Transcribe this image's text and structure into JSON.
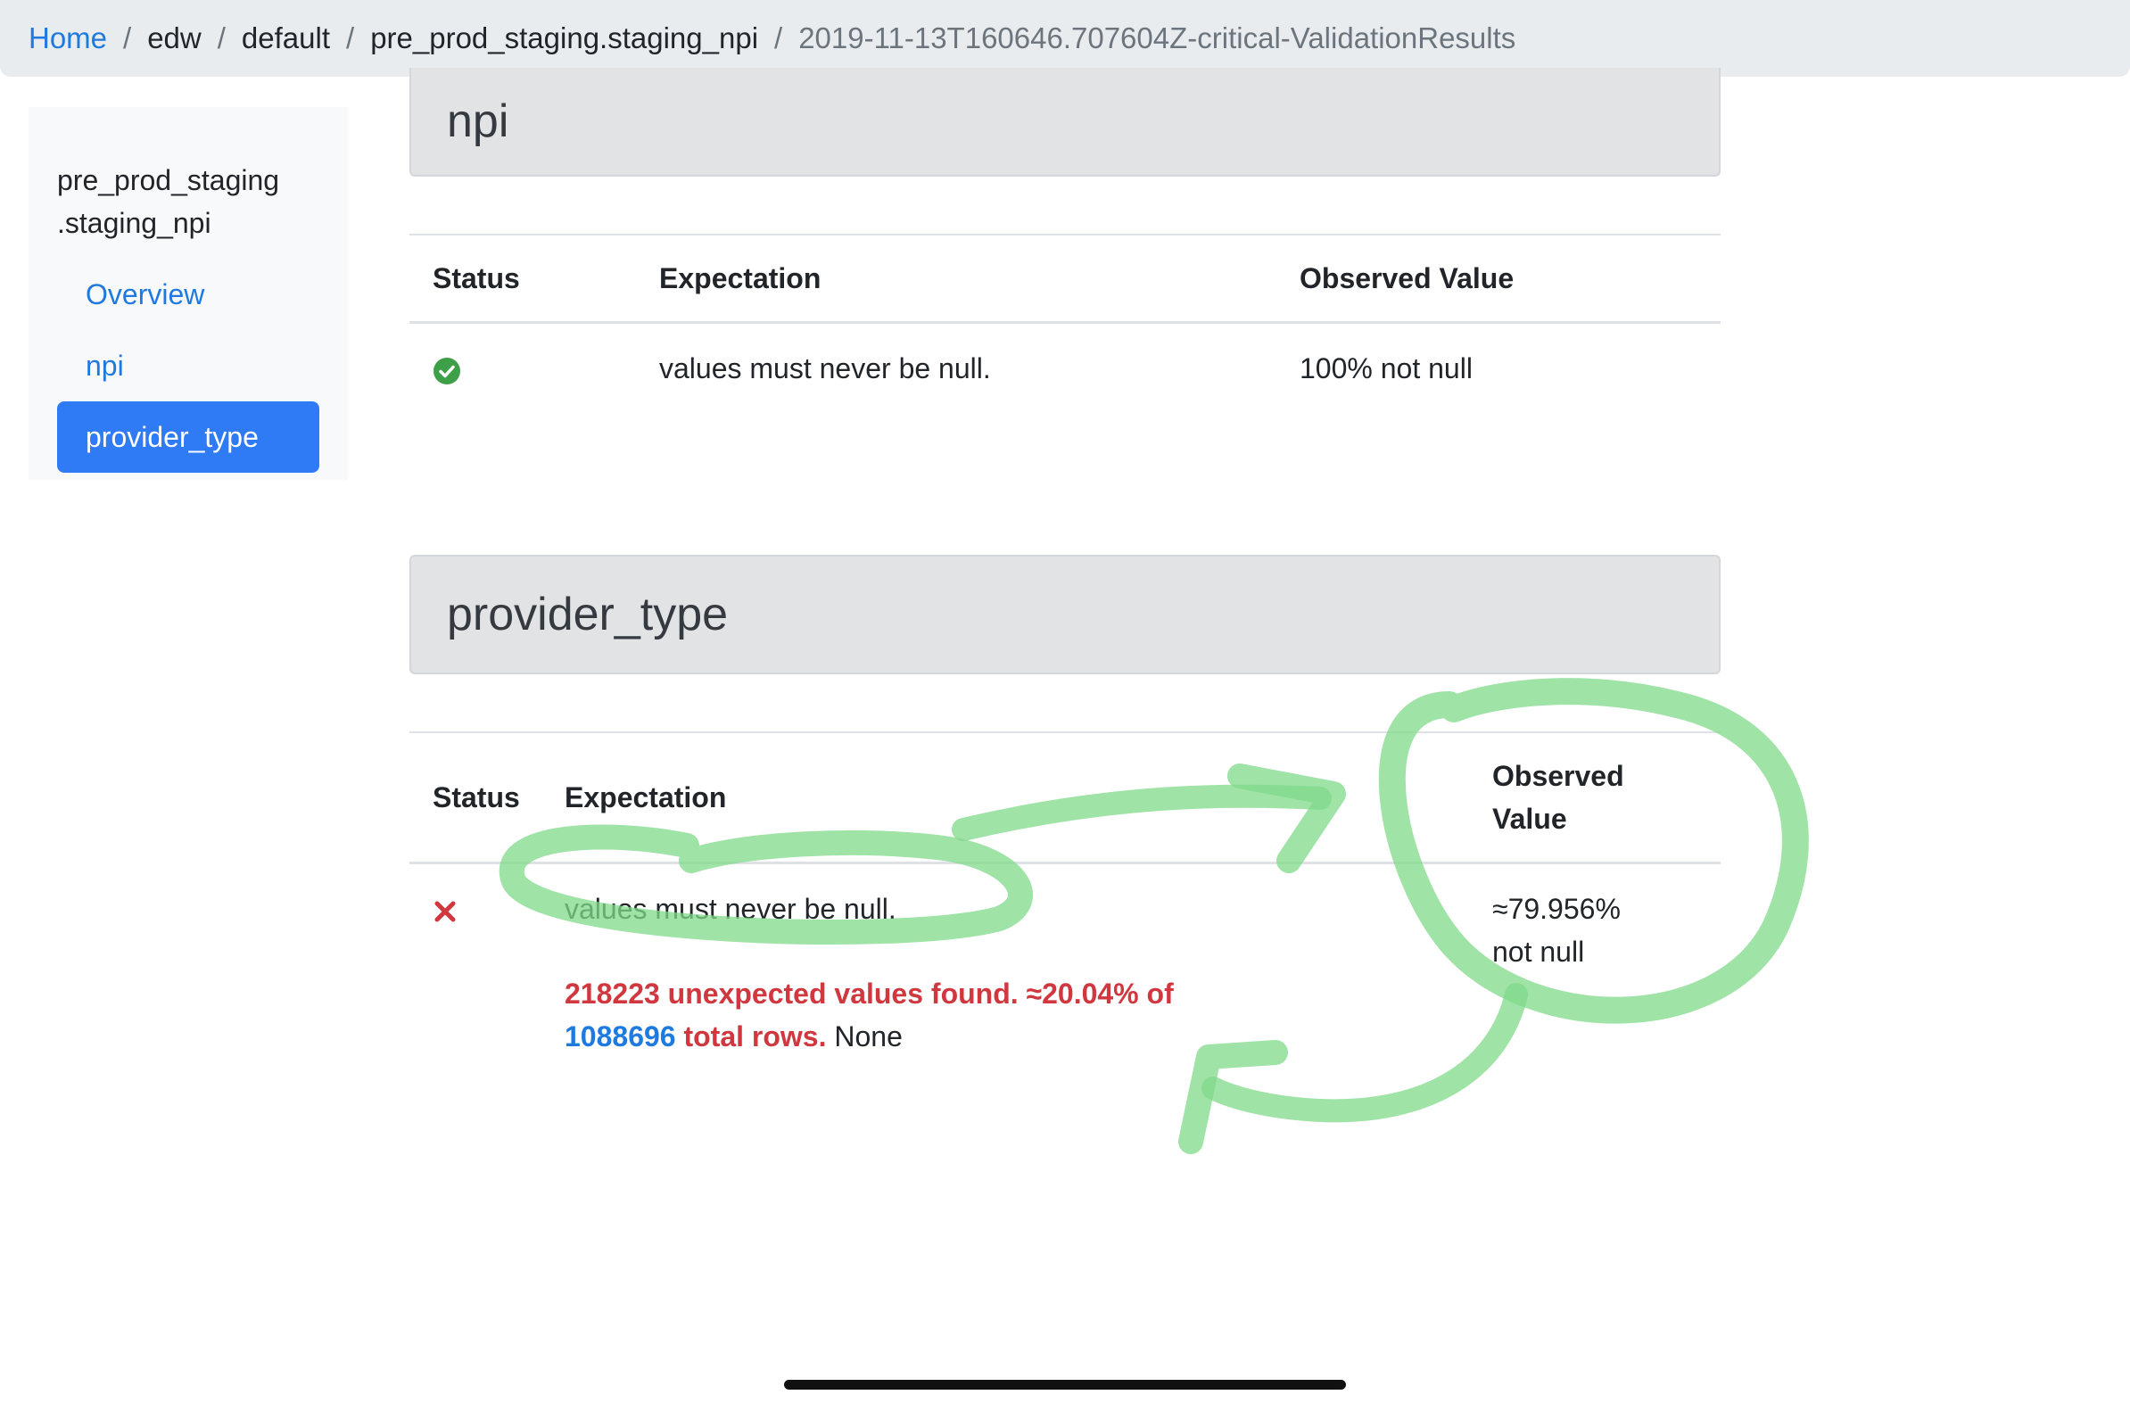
{
  "breadcrumb": {
    "items": [
      "Home",
      "edw",
      "default",
      "pre_prod_staging.staging_npi"
    ],
    "current": "2019-11-13T160646.707604Z-critical-ValidationResults",
    "separator": "/"
  },
  "sidebar": {
    "table_name_line1": "pre_prod_staging",
    "table_name_line2": ".staging_npi",
    "items": [
      {
        "label": "Overview",
        "active": false
      },
      {
        "label": "npi",
        "active": false
      },
      {
        "label": "provider_type",
        "active": true
      }
    ]
  },
  "sections": [
    {
      "title": "npi",
      "columns": [
        "Status",
        "Expectation",
        "Observed Value"
      ],
      "rows": [
        {
          "status": "success",
          "status_icon": "check-circle-icon",
          "expectation": "values must never be null.",
          "observed": "100% not null"
        }
      ]
    },
    {
      "title": "provider_type",
      "columns": [
        "Status",
        "Expectation",
        "Observed Value"
      ],
      "rows": [
        {
          "status": "failure",
          "status_icon": "x-icon",
          "expectation": "values must never be null.",
          "unexpected_part1": "218223 unexpected values found. ≈20.04% of ",
          "unexpected_total": "1088696",
          "unexpected_part2": " total rows.",
          "unexpected_suffix": " None",
          "observed": "≈79.956% not null"
        }
      ]
    }
  ],
  "colors": {
    "accent": "#1f7ae0",
    "active_nav": "#2f7bf6",
    "success": "#3da048",
    "failure": "#d0373f",
    "annotation": "#7fd98a"
  }
}
